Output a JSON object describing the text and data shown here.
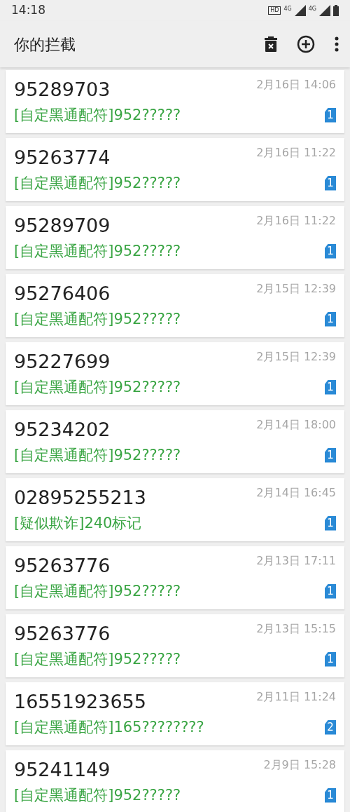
{
  "status_bar": {
    "time": "14:18",
    "hd": "HD",
    "network_1": "4G",
    "network_2": "4G"
  },
  "toolbar": {
    "title": "你的拦截"
  },
  "calls": [
    {
      "number": "95289703",
      "time": "2月16日 14:06",
      "tag": "[自定黑通配符]952?????",
      "sim": "1"
    },
    {
      "number": "95263774",
      "time": "2月16日 11:22",
      "tag": "[自定黑通配符]952?????",
      "sim": "1"
    },
    {
      "number": "95289709",
      "time": "2月16日 11:22",
      "tag": "[自定黑通配符]952?????",
      "sim": "1"
    },
    {
      "number": "95276406",
      "time": "2月15日 12:39",
      "tag": "[自定黑通配符]952?????",
      "sim": "1"
    },
    {
      "number": "95227699",
      "time": "2月15日 12:39",
      "tag": "[自定黑通配符]952?????",
      "sim": "1"
    },
    {
      "number": "95234202",
      "time": "2月14日 18:00",
      "tag": "[自定黑通配符]952?????",
      "sim": "1"
    },
    {
      "number": "02895255213",
      "time": "2月14日 16:45",
      "tag": "[疑似欺诈]240标记",
      "sim": "1"
    },
    {
      "number": "95263776",
      "time": "2月13日 17:11",
      "tag": "[自定黑通配符]952?????",
      "sim": "1"
    },
    {
      "number": "95263776",
      "time": "2月13日 15:15",
      "tag": "[自定黑通配符]952?????",
      "sim": "1"
    },
    {
      "number": "16551923655",
      "time": "2月11日 11:24",
      "tag": "[自定黑通配符]165????????",
      "sim": "2"
    },
    {
      "number": "95241149",
      "time": "2月9日 15:28",
      "tag": "[自定黑通配符]952?????",
      "sim": "1"
    }
  ]
}
